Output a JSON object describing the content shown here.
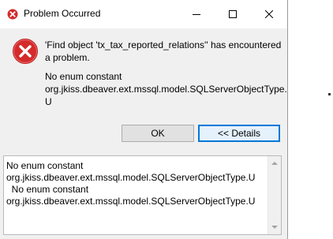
{
  "window": {
    "title": "Problem Occurred",
    "controls": {
      "minimize_icon": "minimize-icon",
      "maximize_icon": "maximize-icon",
      "close_icon": "close-icon"
    }
  },
  "message": {
    "icon": "error-icon",
    "headline_line1": "'Find object 'tx_tax_reported_relations'' has encountered",
    "headline_line2": "a problem.",
    "detail_line1": "No enum constant",
    "detail_line2": "org.jkiss.dbeaver.ext.mssql.model.SQLServerObjectType.",
    "detail_line3": "U"
  },
  "buttons": {
    "ok_label": "OK",
    "details_label": "<< Details"
  },
  "details": {
    "lines": [
      "No enum constant",
      "org.jkiss.dbeaver.ext.mssql.model.SQLServerObjectType.U",
      "  No enum constant",
      "org.jkiss.dbeaver.ext.mssql.model.SQLServerObjectType.U"
    ]
  },
  "colors": {
    "error_red": "#d42b2b",
    "focus_blue": "#0078d7",
    "dialog_bg": "#f0f0f0"
  }
}
